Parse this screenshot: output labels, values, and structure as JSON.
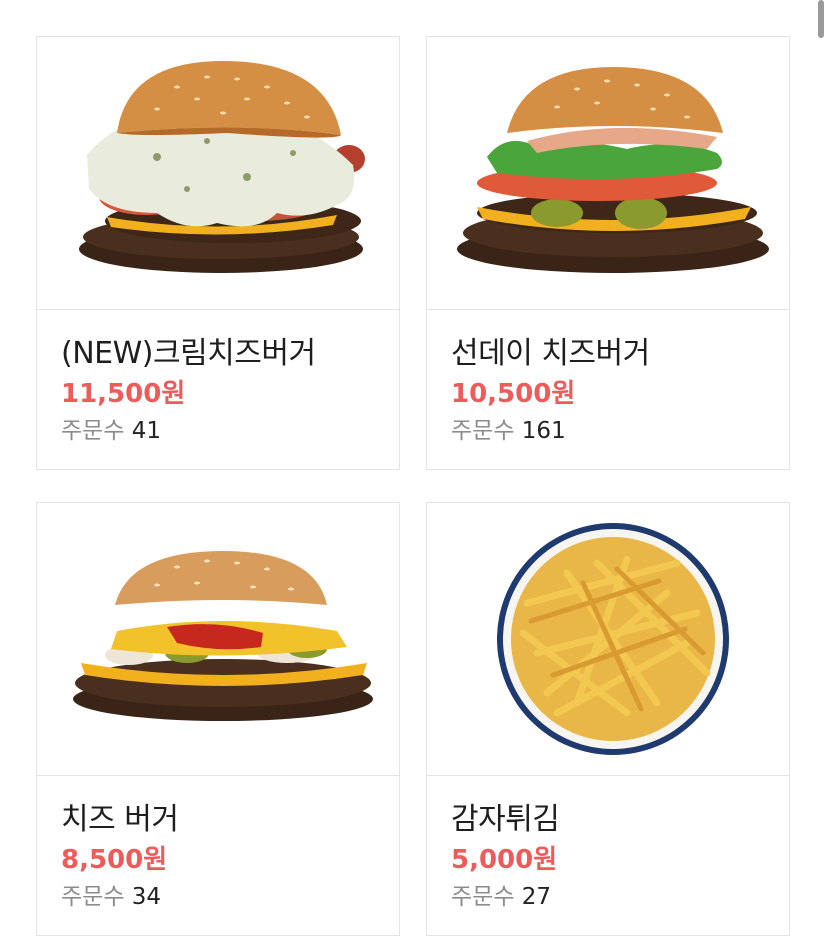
{
  "menu": {
    "items": [
      {
        "name": "(NEW)크림치즈버거",
        "price": "11,500원",
        "orders_label": "주문수",
        "orders": "41",
        "image": "cream-cheese-burger-photo"
      },
      {
        "name": "선데이 치즈버거",
        "price": "10,500원",
        "orders_label": "주문수",
        "orders": "161",
        "image": "sunday-cheeseburger-photo"
      },
      {
        "name": "치즈 버거",
        "price": "8,500원",
        "orders_label": "주문수",
        "orders": "34",
        "image": "cheeseburger-photo"
      },
      {
        "name": "감자튀김",
        "price": "5,000원",
        "orders_label": "주문수",
        "orders": "27",
        "image": "french-fries-photo"
      }
    ]
  },
  "colors": {
    "price": "#ee5b5b",
    "border": "#e4e4e4",
    "muted": "#8c8c8c"
  }
}
